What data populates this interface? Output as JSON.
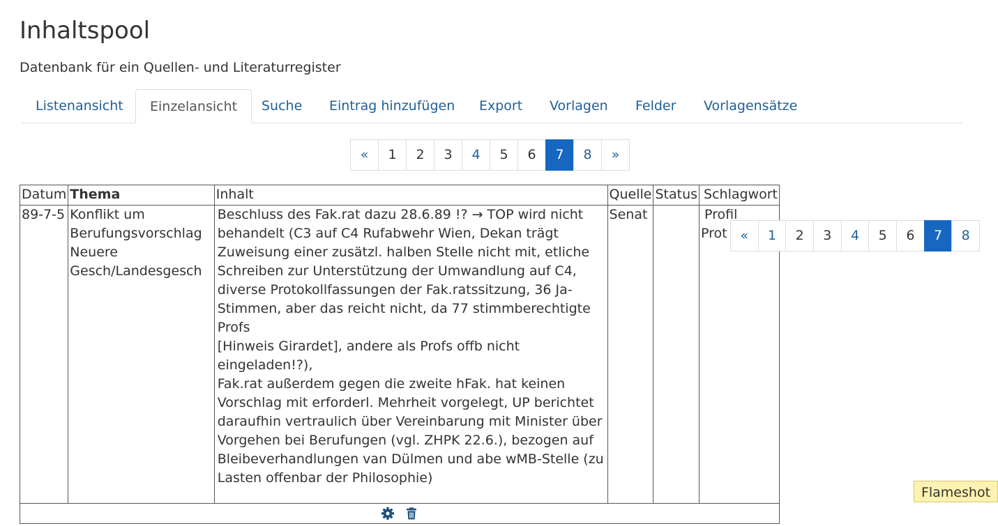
{
  "header": {
    "title": "Inhaltspool",
    "subtitle": "Datenbank für ein Quellen- und Literaturregister"
  },
  "tabs": [
    {
      "label": "Listenansicht"
    },
    {
      "label": "Einzelansicht",
      "active": true
    },
    {
      "label": "Suche"
    },
    {
      "label": "Eintrag hinzufügen"
    },
    {
      "label": "Export"
    },
    {
      "label": "Vorlagen"
    },
    {
      "label": "Felder"
    },
    {
      "label": "Vorlagensätze"
    }
  ],
  "pagination": {
    "prev": "«",
    "next": "»",
    "pages": [
      "1",
      "2",
      "3",
      "4",
      "5",
      "6",
      "7",
      "8"
    ],
    "current": "7"
  },
  "overlay_pagination": {
    "prev": "«",
    "pages": [
      "1",
      "2",
      "3",
      "4",
      "5",
      "6",
      "7",
      "8"
    ],
    "current": "7"
  },
  "table": {
    "headers": {
      "datum": "Datum",
      "thema": "Thema",
      "inhalt": "Inhalt",
      "quelle": "Quelle",
      "status": "Status",
      "schlagwort": "Schlagwort"
    },
    "row": {
      "datum": "89-7-5",
      "thema": [
        "Konflikt um",
        "Berufungsvorschlag",
        "Neuere",
        "Gesch/Landesgesch"
      ],
      "inhalt": [
        "Beschluss des Fak.rat dazu 28.6.89 !? → TOP wird nicht",
        "behandelt (C3 auf C4 Rufabwehr Wien, Dekan trägt",
        "Zuweisung einer zusätzl. halben Stelle nicht mit, etliche",
        "Schreiben zur Unterstützung der Umwandlung auf C4,",
        "diverse Protokollfassungen der Fak.ratssitzung, 36 Ja-",
        "Stimmen, aber das reicht nicht, da 77 stimmberechtigte Profs",
        "[Hinweis Girardet], andere als Profs offb nicht eingeladen!?),",
        "Fak.rat außerdem gegen die zweite hFak. hat keinen",
        "Vorschlag mit erforderl. Mehrheit vorgelegt, UP berichtet",
        "daraufhin vertraulich über Vereinbarung mit Minister über",
        "Vorgehen bei Berufungen (vgl. ZHPK 22.6.), bezogen auf",
        "Bleibeverhandlungen van Dülmen und abe wMB-Stelle (zu",
        "Lasten offenbar der Philosophie)"
      ],
      "quelle": "Senat",
      "status": "",
      "schlagwort": [
        "Profil",
        "Prot"
      ]
    },
    "actions": {
      "edit_icon": "gear-icon",
      "delete_icon": "trash-icon"
    }
  },
  "tray": {
    "label": "Flameshot"
  },
  "colors": {
    "link": "#1f5f96",
    "active_page": "#1767c0",
    "tray_bg": "#fdf2b0"
  }
}
